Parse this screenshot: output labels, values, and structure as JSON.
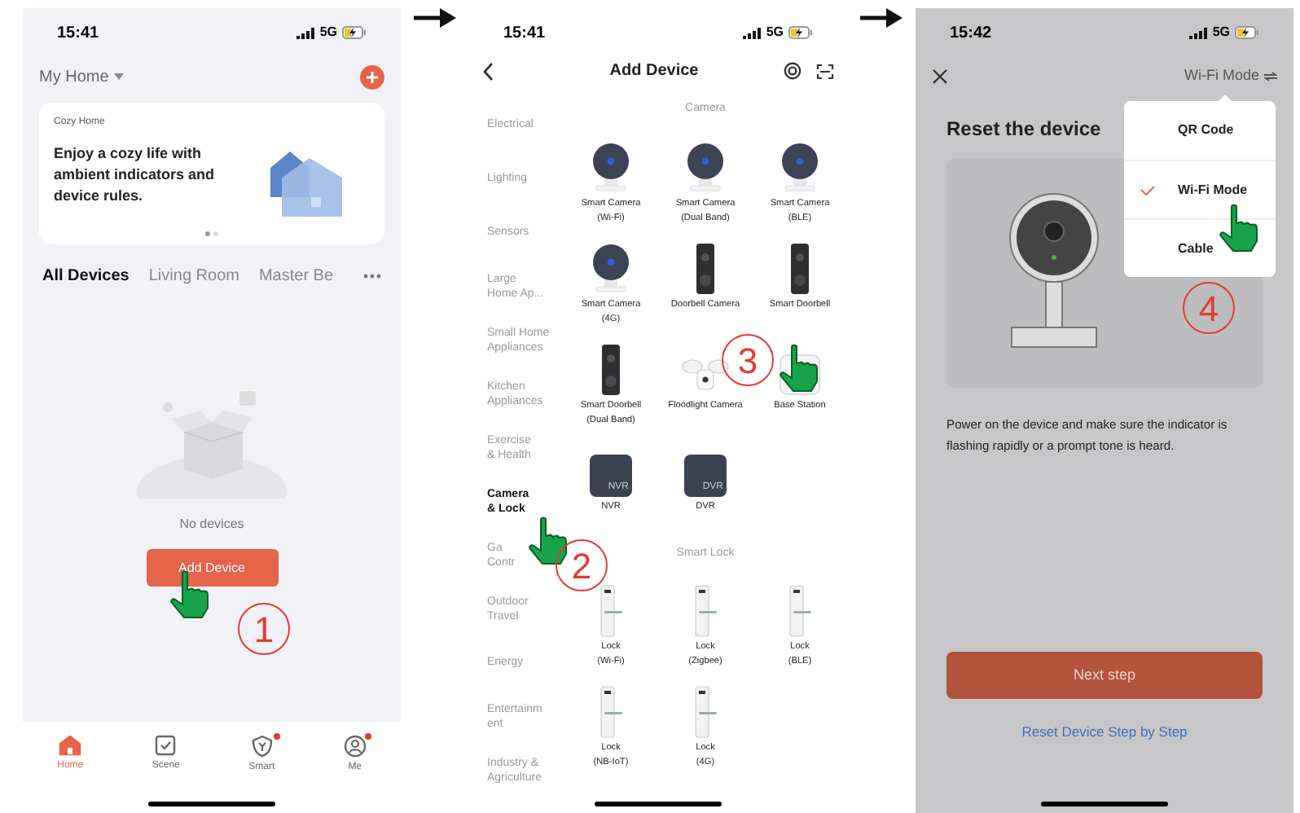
{
  "home": {
    "status": {
      "time": "15:41",
      "network": "5G"
    },
    "home_name": "My Home",
    "banner": {
      "label": "Cozy Home",
      "text": "Enjoy a cozy life with ambient indicators and device rules.",
      "pages": [
        {
          "selected": true
        },
        {
          "selected": false
        }
      ]
    },
    "rooms": [
      {
        "label": "All Devices",
        "selected": true
      },
      {
        "label": "Living Room",
        "selected": false
      },
      {
        "label": "Master Be",
        "selected": false
      }
    ],
    "empty_text": "No devices",
    "add_button": "Add Device",
    "step": "1",
    "tabbar": [
      {
        "label": "Home",
        "kind": "home",
        "selected": true,
        "badge": false
      },
      {
        "label": "Scene",
        "kind": "scene",
        "selected": false,
        "badge": false
      },
      {
        "label": "Smart",
        "kind": "smart",
        "selected": false,
        "badge": true
      },
      {
        "label": "Me",
        "kind": "me",
        "selected": false,
        "badge": true
      }
    ]
  },
  "add_device": {
    "status": {
      "time": "15:41",
      "network": "5G"
    },
    "title": "Add Device",
    "categories": [
      {
        "label": "Electrical",
        "selected": false
      },
      {
        "label": "Lighting",
        "selected": false
      },
      {
        "label": "Sensors",
        "selected": false
      },
      {
        "label": "Large\nHome Ap...",
        "selected": false
      },
      {
        "label": "Small Home\nAppliances",
        "selected": false
      },
      {
        "label": "Kitchen\nAppliances",
        "selected": false
      },
      {
        "label": "Exercise\n& Health",
        "selected": false
      },
      {
        "label": "Camera\n& Lock",
        "selected": true
      },
      {
        "label": "Ga\nContr",
        "selected": false
      },
      {
        "label": "Outdoor\nTravel",
        "selected": false
      },
      {
        "label": "Energy",
        "selected": false
      },
      {
        "label": "Entertainm\nent",
        "selected": false
      },
      {
        "label": "Industry &\nAgriculture",
        "selected": false
      }
    ],
    "sections": [
      {
        "title": "Camera",
        "devices": [
          {
            "name": "Smart Camera\n(Wi-Fi)",
            "kind": "camera"
          },
          {
            "name": "Smart Camera\n(Dual Band)",
            "kind": "camera"
          },
          {
            "name": "Smart Camera\n(BLE)",
            "kind": "camera"
          },
          {
            "name": "Smart Camera\n(4G)",
            "kind": "camera"
          },
          {
            "name": "Doorbell Camera",
            "kind": "doorbell"
          },
          {
            "name": "Smart Doorbell",
            "kind": "doorbell"
          },
          {
            "name": "Smart Doorbell\n(Dual Band)",
            "kind": "doorbell"
          },
          {
            "name": "Floodlight Camera",
            "kind": "floodlight"
          },
          {
            "name": "Base Station",
            "kind": "base"
          },
          {
            "name": "NVR",
            "kind": "recorder",
            "icon_text": "NVR"
          },
          {
            "name": "DVR",
            "kind": "recorder",
            "icon_text": "DVR"
          }
        ]
      },
      {
        "title": "Smart Lock",
        "devices": [
          {
            "name": "Lock\n(Wi-Fi)",
            "kind": "lock"
          },
          {
            "name": "Lock\n(Zigbee)",
            "kind": "lock"
          },
          {
            "name": "Lock\n(BLE)",
            "kind": "lock"
          },
          {
            "name": "Lock\n(NB-IoT)",
            "kind": "lock"
          },
          {
            "name": "Lock\n(4G)",
            "kind": "lock"
          }
        ]
      }
    ],
    "steps": [
      "2",
      "3"
    ]
  },
  "reset": {
    "status": {
      "time": "15:42",
      "network": "5G"
    },
    "mode": "Wi-Fi Mode",
    "title": "Reset the device",
    "menu": [
      {
        "label": "QR Code",
        "selected": false
      },
      {
        "label": "Wi-Fi Mode",
        "selected": true
      },
      {
        "label": "Cable",
        "selected": false
      }
    ],
    "description": "Power on the device and make sure the indicator is flashing rapidly or a prompt tone is heard.",
    "next_button": "Next step",
    "link": "Reset Device Step by Step",
    "step": "4"
  }
}
